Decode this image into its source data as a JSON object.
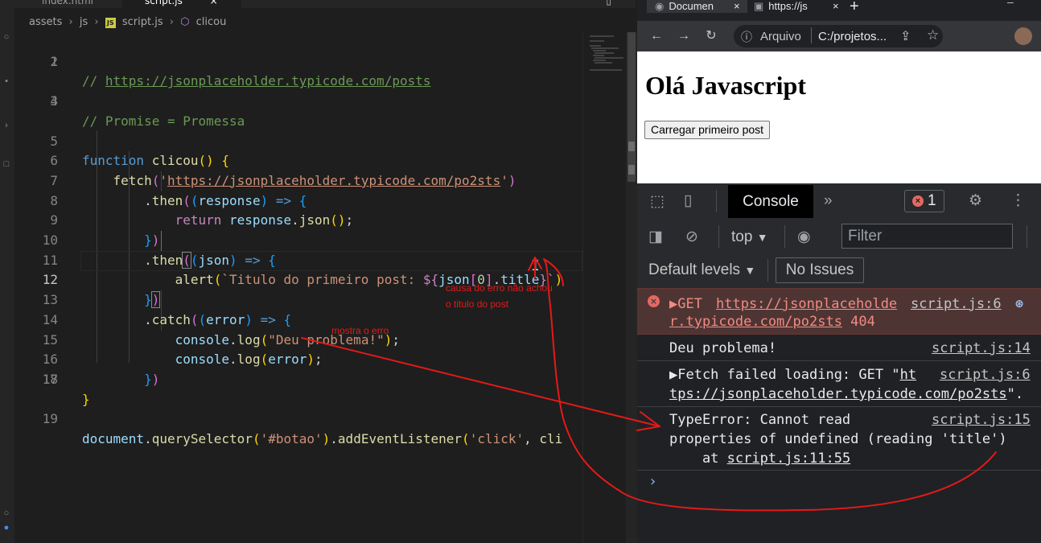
{
  "editor": {
    "tabs": [
      {
        "label": "index.html"
      },
      {
        "label": "script.js",
        "close": "×"
      }
    ],
    "breadcrumb": {
      "folder1": "assets",
      "folder2": "js",
      "file": "script.js",
      "symbol": "clicou",
      "js_badge": "JS"
    },
    "lines": [
      {
        "n": "1"
      },
      {
        "n": "2"
      },
      {
        "n": "3"
      },
      {
        "n": "4"
      },
      {
        "n": "5"
      },
      {
        "n": "6"
      },
      {
        "n": "7"
      },
      {
        "n": "8"
      },
      {
        "n": "9"
      },
      {
        "n": "10"
      },
      {
        "n": "11"
      },
      {
        "n": "12"
      },
      {
        "n": "13"
      },
      {
        "n": "14"
      },
      {
        "n": "15"
      },
      {
        "n": "16"
      },
      {
        "n": "17"
      },
      {
        "n": "18"
      },
      {
        "n": "19"
      }
    ],
    "code": {
      "l1_comment": "// ",
      "l1_url": "https://jsonplaceholder.typicode.com/posts",
      "l3_comment": "// Promise = Promessa",
      "l5_kw": "function",
      "l5_fn": "clicou",
      "l6_fn": "fetch",
      "l6_q1": "'",
      "l6_url": "https://jsonplaceholder.typicode.com/po2sts",
      "l6_q2": "'",
      "then": "then",
      "response": "response",
      "arrow": "=>",
      "return": "return",
      "json_m": "json",
      "json_v": "json",
      "alert": "alert",
      "tpl_text": "`Titulo do primeiro post: ",
      "tpl_open": "${",
      "idx": "0",
      "title": "title",
      "tpl_end": "}`",
      "catch": "catch",
      "error": "error",
      "console": "console",
      "log": "log",
      "deu_problema": "\"Deu problema!\"",
      "document": "document",
      "qs": "querySelector",
      "botao": "'#botao'",
      "ael": "addEventListener",
      "click": "'click'",
      "cli": "cli"
    },
    "annotations": {
      "cause_line1": "causa do erro não achou",
      "cause_line2": "o titulo do post",
      "shows_error": "mostra o erro"
    }
  },
  "browser": {
    "tabs": [
      {
        "label": "Documen",
        "close": "×"
      },
      {
        "label": "https://js",
        "close": "×"
      }
    ],
    "new_tab": "+",
    "omnibox": {
      "security": "Arquivo",
      "url": "C:/projetos..."
    },
    "page": {
      "heading": "Olá Javascript",
      "button": "Carregar primeiro post"
    },
    "devtools": {
      "console_tab": "Console",
      "more_tabs": "»",
      "error_count": "1",
      "context": "top",
      "filter_placeholder": "Filter",
      "levels": "Default levels",
      "issues": "No Issues",
      "messages": {
        "get_prefix": "▶GET ",
        "get_url1": "https://jsonplaceholde",
        "get_url2": "r.typicode.com/po2sts",
        "get_status": " 404",
        "get_src": "script.js:6",
        "deu": "Deu problema!",
        "deu_src": "script.js:14",
        "fetch_prefix": "▶Fetch failed loading: GET \"",
        "fetch_url1": "ht",
        "fetch_url2": "tps://jsonplaceholder.typicode.com/po2sts",
        "fetch_end": "\".",
        "fetch_src": "script.js:6",
        "type_line1": "TypeError: Cannot read",
        "type_line2": "properties of undefined (reading 'title')",
        "type_line3_prefix": "    at ",
        "type_line3_src": "script.js:11:55",
        "type_src": "script.js:15"
      },
      "prompt": "›"
    }
  },
  "colors": {
    "annotation": "#e51919",
    "error_bg": "#4e3534",
    "editor_bg": "#1e1e1e",
    "devtools_bg": "#202124"
  }
}
